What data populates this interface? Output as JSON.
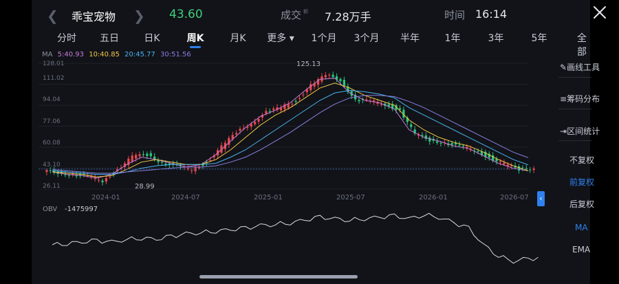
{
  "header": {
    "back_icon": "chevron-left-icon",
    "stock_name": "乖宝宠物",
    "price": "43.60",
    "next_icon": "chevron-right-icon",
    "volume_label": "成交",
    "volume_sup": "额",
    "volume_value": "7.28万手",
    "time_label": "时间",
    "time_value": "16:14",
    "close_icon": "close-icon"
  },
  "tabs": [
    {
      "label": "分时"
    },
    {
      "label": "五日"
    },
    {
      "label": "日K"
    },
    {
      "label": "周K",
      "active": true
    },
    {
      "label": "月K"
    },
    {
      "label": "更多 ▾"
    },
    {
      "label": "1个月"
    },
    {
      "label": "3个月"
    },
    {
      "label": "半年"
    },
    {
      "label": "1年"
    },
    {
      "label": "3年"
    },
    {
      "label": "5年"
    },
    {
      "label": "全部"
    }
  ],
  "ma_legend": {
    "label": "MA",
    "ma5": "5:40.93",
    "ma10": "10:40.85",
    "ma20": "20:45.77",
    "ma30": "30:51.56"
  },
  "price_axis": [
    "128.01",
    "111.02",
    "94.04",
    "77.06",
    "60.08",
    "43.10",
    "26.11"
  ],
  "date_axis": [
    "2024-01",
    "2024-07",
    "2025-01",
    "2025-07",
    "2026-01",
    "2026-07"
  ],
  "annotations": {
    "high": "125.13",
    "low": "28.99"
  },
  "obv": {
    "label": "OBV",
    "value": "-1475997"
  },
  "sidebar": {
    "draw_tool": "画线工具",
    "chip_dist": "筹码分布",
    "range_stats": "区间统计",
    "no_adjust": "不复权",
    "pre_adjust": "前复权",
    "post_adjust": "后复权",
    "ma": "MA",
    "ema": "EMA"
  },
  "colors": {
    "up": "#e8484c",
    "down": "#2cc57c",
    "price_green": "#3fcf7a",
    "accent_blue": "#2f80ed",
    "ma5": "#c77ad8",
    "ma10": "#f3c845",
    "ma20": "#4ab3f0",
    "ma30": "#8a7fe0"
  },
  "chart_data": {
    "type": "candlestick",
    "title": "",
    "x": [
      "2023-11",
      "2023-12",
      "2024-01",
      "2024-02",
      "2024-03",
      "2024-04",
      "2024-05",
      "2024-06",
      "2024-07",
      "2024-08",
      "2024-09",
      "2024-10",
      "2024-11",
      "2024-12",
      "2025-01",
      "2025-02",
      "2025-03",
      "2025-04",
      "2025-05",
      "2025-06",
      "2025-07",
      "2025-08",
      "2025-09",
      "2025-10",
      "2025-11",
      "2025-12",
      "2026-01",
      "2026-02",
      "2026-03",
      "2026-04",
      "2026-05",
      "2026-06",
      "2026-07"
    ],
    "close": [
      40,
      38,
      36,
      33,
      42,
      52,
      54,
      48,
      44,
      42,
      48,
      60,
      72,
      80,
      88,
      92,
      98,
      110,
      118,
      115,
      98,
      97,
      95,
      90,
      70,
      66,
      64,
      60,
      58,
      52,
      46,
      42,
      43.6
    ],
    "high_point": 125.13,
    "low_point": 28.99,
    "ylim": [
      26.11,
      128.01
    ],
    "series": [
      {
        "name": "MA5",
        "values": [
          40,
          38,
          37,
          35,
          38,
          46,
          52,
          50,
          47,
          44,
          46,
          54,
          65,
          76,
          85,
          90,
          96,
          106,
          115,
          116,
          104,
          98,
          96,
          91,
          74,
          68,
          65,
          61,
          59,
          53,
          47,
          43,
          40.93
        ]
      },
      {
        "name": "MA10",
        "values": [
          40,
          39,
          38,
          36,
          37,
          42,
          48,
          50,
          48,
          46,
          46,
          50,
          58,
          68,
          78,
          86,
          92,
          100,
          108,
          112,
          108,
          102,
          98,
          94,
          82,
          74,
          68,
          64,
          61,
          56,
          50,
          45,
          40.85
        ]
      },
      {
        "name": "MA20",
        "values": [
          41,
          40,
          39,
          38,
          38,
          40,
          43,
          45,
          46,
          46,
          46,
          47,
          52,
          58,
          66,
          74,
          82,
          90,
          98,
          104,
          106,
          105,
          103,
          100,
          92,
          86,
          80,
          74,
          68,
          62,
          56,
          50,
          45.77
        ]
      },
      {
        "name": "MA30",
        "values": [
          42,
          41,
          40,
          39,
          39,
          40,
          41,
          42,
          43,
          44,
          44,
          45,
          48,
          52,
          58,
          65,
          72,
          80,
          88,
          95,
          100,
          102,
          102,
          101,
          97,
          92,
          86,
          80,
          74,
          68,
          62,
          56,
          51.56
        ]
      }
    ],
    "obv": [
      -10,
      -9,
      -8,
      -7,
      -8,
      -6,
      -5,
      -6,
      -4,
      -2,
      -1,
      0,
      1,
      2,
      4,
      5,
      6,
      8,
      10,
      9,
      8,
      9,
      10,
      11,
      9,
      12,
      10,
      6,
      2,
      -10,
      -18,
      -22,
      -20
    ]
  }
}
